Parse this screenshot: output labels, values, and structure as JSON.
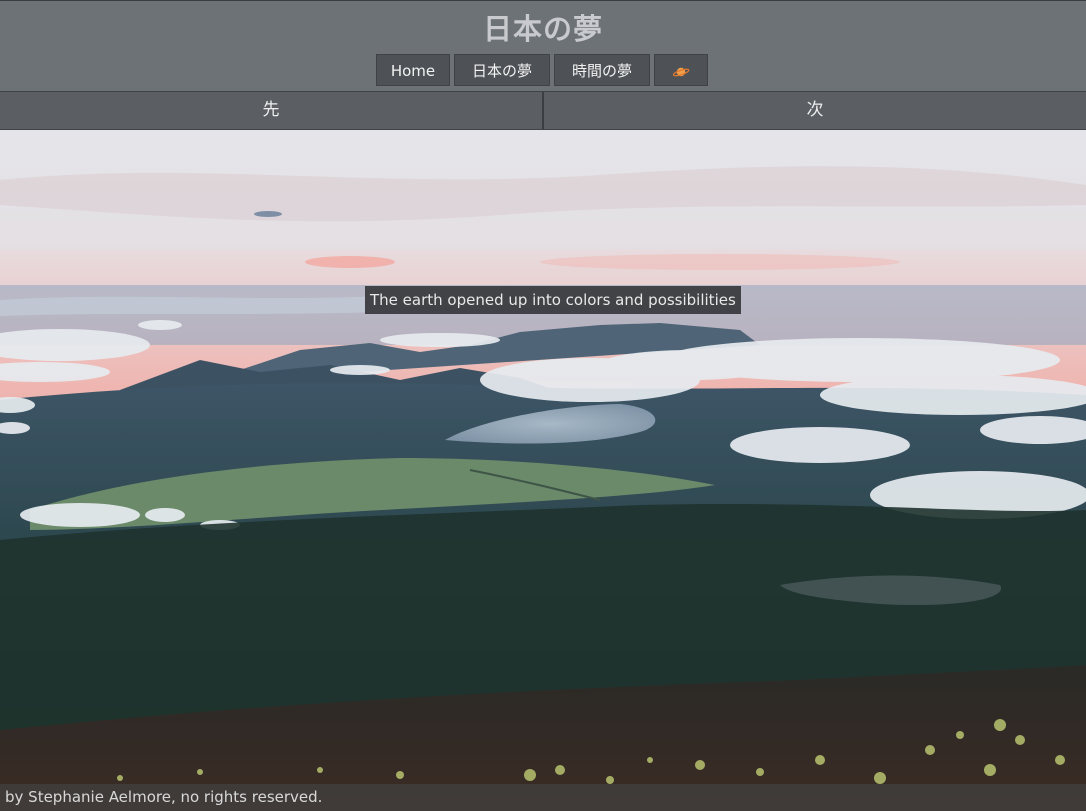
{
  "site": {
    "title": "日本の夢"
  },
  "nav": {
    "items": [
      {
        "label": "Home"
      },
      {
        "label": "日本の夢"
      },
      {
        "label": "時間の夢"
      },
      {
        "label": "🪐",
        "icon": "planet-icon"
      }
    ]
  },
  "pager": {
    "prev_label": "先",
    "next_label": "次"
  },
  "photo": {
    "caption": "The earth opened up into colors and possibilities"
  },
  "footer": {
    "credit": "by Stephanie Aelmore, no rights reserved."
  },
  "colors": {
    "header_bg": "#64686e",
    "nav_button_bg": "#4e5257",
    "pager_bg": "#5b5f64",
    "caption_bg": "#3a3c40",
    "title_text": "#c8cacd"
  }
}
